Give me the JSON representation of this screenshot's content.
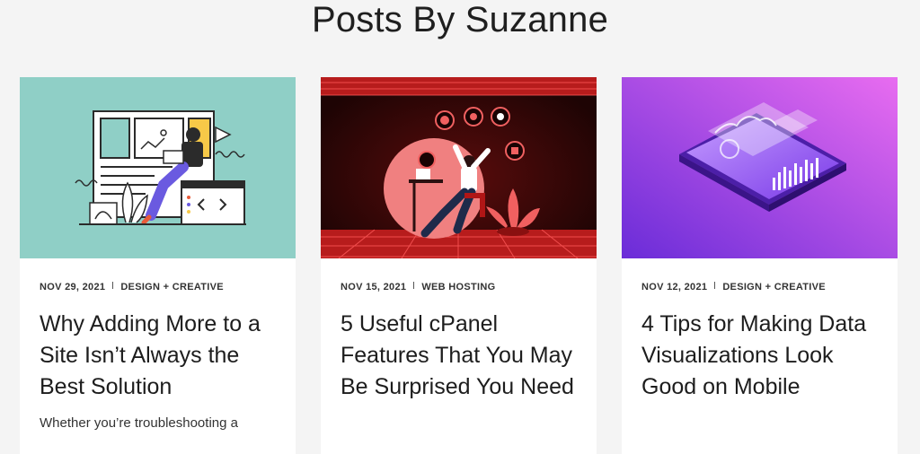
{
  "page": {
    "title": "Posts By Suzanne"
  },
  "posts": [
    {
      "date": "NOV 29, 2021",
      "category": "DESIGN + CREATIVE",
      "title": "Why Adding More to a Site Isn’t Always the Best Solution",
      "excerpt": "Whether you’re troubleshooting a",
      "image_icon": "web-designer-illustration",
      "image_bg": "#8fcfc6"
    },
    {
      "date": "NOV 15, 2021",
      "category": "WEB HOSTING",
      "title": "5 Useful cPanel Features That You May Be Surprised You Need",
      "image_icon": "cpanel-user-illustration",
      "image_bg": "#3a0808"
    },
    {
      "date": "NOV 12, 2021",
      "category": "DESIGN + CREATIVE",
      "title": "4 Tips for Making Data Visualizations Look Good on Mobile",
      "image_icon": "mobile-data-visualization-illustration",
      "image_bg": "#8a3ef0"
    }
  ]
}
